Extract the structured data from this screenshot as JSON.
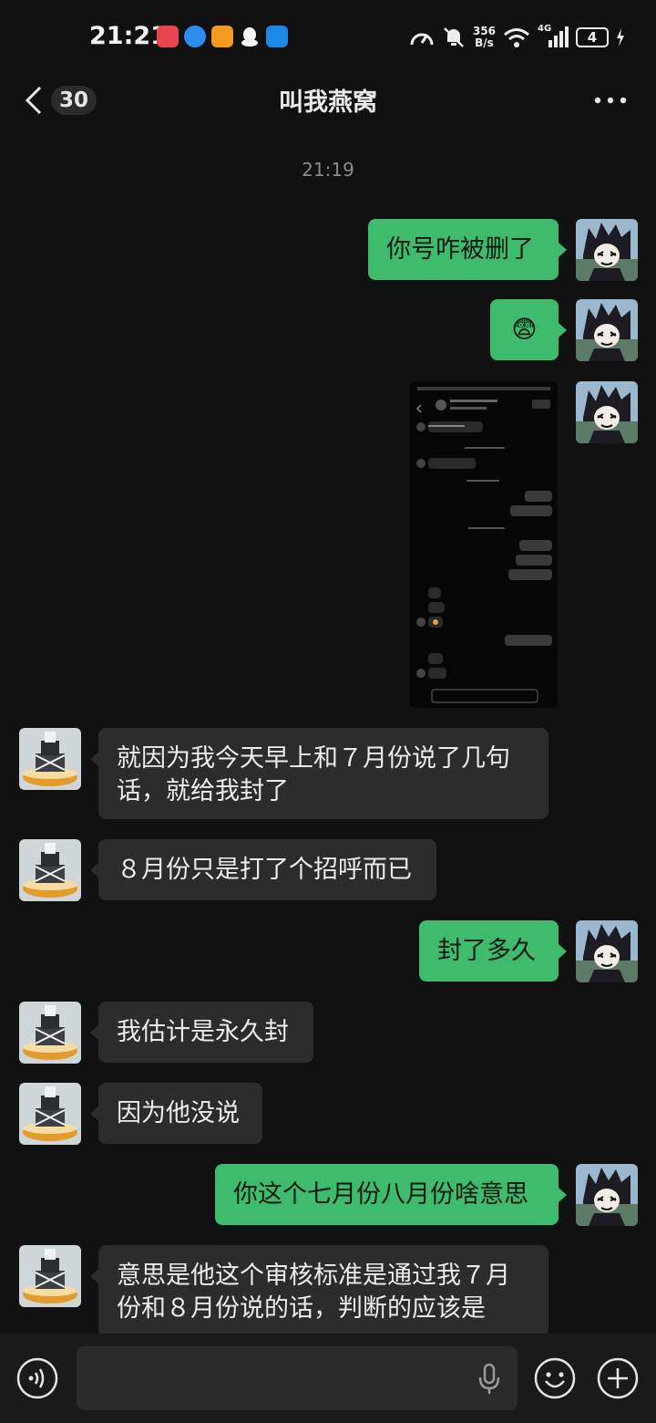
{
  "status_bar": {
    "time": "21:21",
    "net_speed_value": "356",
    "net_speed_unit": "B/s",
    "network_type": "4G",
    "battery": "4",
    "app_icons": [
      "huawei-icon",
      "browser-icon",
      "video-icon",
      "qq-icon",
      "cloud-icon"
    ]
  },
  "header": {
    "unread_count": "30",
    "title": "叫我燕窝"
  },
  "chat": {
    "timestamp": "21:19",
    "messages": [
      {
        "sender": "me",
        "type": "text",
        "text": "你号咋被删了"
      },
      {
        "sender": "me",
        "type": "emoji",
        "text": "😨"
      },
      {
        "sender": "me",
        "type": "image",
        "text": ""
      },
      {
        "sender": "them",
        "type": "text",
        "text": "就因为我今天早上和７月份说了几句话，就给我封了"
      },
      {
        "sender": "them",
        "type": "text",
        "text": "８月份只是打了个招呼而已"
      },
      {
        "sender": "me",
        "type": "text",
        "text": "封了多久"
      },
      {
        "sender": "them",
        "type": "text",
        "text": "我估计是永久封"
      },
      {
        "sender": "them",
        "type": "text",
        "text": "因为他没说"
      },
      {
        "sender": "me",
        "type": "text",
        "text": "你这个七月份八月份啥意思"
      },
      {
        "sender": "them",
        "type": "text",
        "text": "意思是他这个审核标准是通过我７月份和８月份说的话，判断的应该是"
      }
    ]
  },
  "colors": {
    "background": "#111111",
    "my_bubble": "#3fbb6e",
    "their_bubble": "#2c2c2c",
    "input_bar": "#1a1a1a"
  }
}
